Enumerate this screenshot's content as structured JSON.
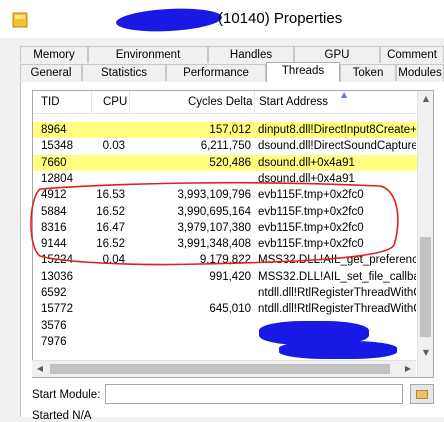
{
  "window": {
    "title": "(10140) Properties"
  },
  "tabs_back": [
    "Memory",
    "Environment",
    "Handles",
    "GPU",
    "Comment"
  ],
  "tabs_front": [
    "General",
    "Statistics",
    "Performance",
    "Threads",
    "Token",
    "Modules"
  ],
  "active_tab": "Threads",
  "columns": {
    "tid": "TID",
    "cpu": "CPU",
    "cycles": "Cycles Delta",
    "address": "Start Address"
  },
  "rows": [
    {
      "tid": "8964",
      "cpu": "",
      "cycles": "157,012",
      "address": "dinput8.dll!DirectInput8Create+...",
      "highlight": true
    },
    {
      "tid": "15348",
      "cpu": "0.03",
      "cycles": "6,211,750",
      "address": "dsound.dll!DirectSoundCaptureE",
      "highlight": false
    },
    {
      "tid": "7660",
      "cpu": "",
      "cycles": "520,486",
      "address": "dsound.dll+0x4a91",
      "highlight": true
    },
    {
      "tid": "12804",
      "cpu": "",
      "cycles": "",
      "address": "dsound.dll+0x4a91",
      "highlight": false
    },
    {
      "tid": "4912",
      "cpu": "16.53",
      "cycles": "3,993,109,796",
      "address": "evb115F.tmp+0x2fc0",
      "highlight": false
    },
    {
      "tid": "5884",
      "cpu": "16.52",
      "cycles": "3,990,695,164",
      "address": "evb115F.tmp+0x2fc0",
      "highlight": false
    },
    {
      "tid": "8316",
      "cpu": "16.47",
      "cycles": "3,979,107,380",
      "address": "evb115F.tmp+0x2fc0",
      "highlight": false
    },
    {
      "tid": "9144",
      "cpu": "16.52",
      "cycles": "3,991,348,408",
      "address": "evb115F.tmp+0x2fc0",
      "highlight": false
    },
    {
      "tid": "15224",
      "cpu": "0.04",
      "cycles": "9,179,822",
      "address": "MSS32.DLL!AIL_get_preference...",
      "highlight": false
    },
    {
      "tid": "13036",
      "cpu": "",
      "cycles": "991,420",
      "address": "MSS32.DLL!AIL_set_file_callbac...",
      "highlight": false
    },
    {
      "tid": "6592",
      "cpu": "",
      "cycles": "",
      "address": "ntdll.dll!RtlRegisterThreadWithC...",
      "highlight": false
    },
    {
      "tid": "15772",
      "cpu": "",
      "cycles": "645,010",
      "address": "ntdll.dll!RtlRegisterThreadWithC...",
      "highlight": false
    },
    {
      "tid": "3576",
      "cpu": "",
      "cycles": "",
      "address": "",
      "highlight": false
    },
    {
      "tid": "7976",
      "cpu": "",
      "cycles": "",
      "address": "",
      "highlight": false
    }
  ],
  "start_module": {
    "label": "Start Module:",
    "value": ""
  },
  "footer_cut_text": "Started    N/A",
  "colors": {
    "highlight": "#ffff80",
    "redaction": "#1919e6",
    "annotation": "#e02020"
  },
  "icons": {
    "title": "process-icon",
    "browse": "folder-icon",
    "sort": "sort-arrow-icon"
  }
}
